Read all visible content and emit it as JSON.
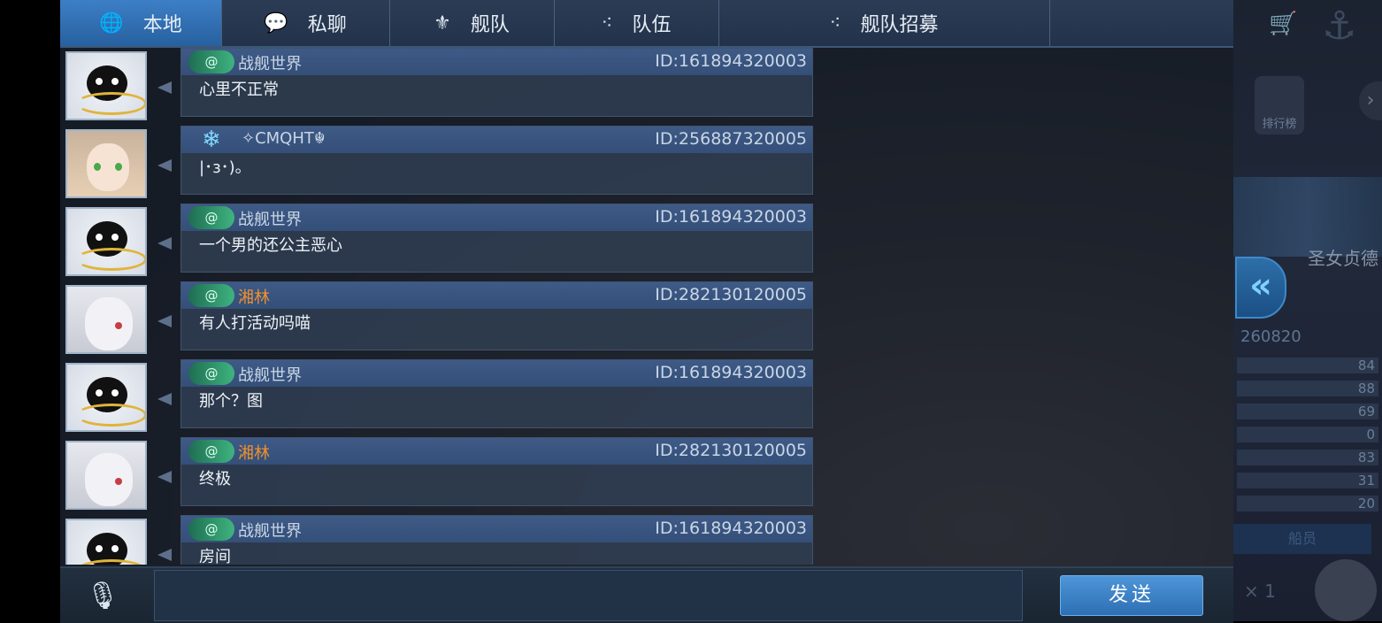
{
  "tabs": [
    {
      "label": "本地",
      "icon": "globe-icon",
      "glyph": "🌐"
    },
    {
      "label": "私聊",
      "icon": "chat-bubble-icon",
      "glyph": "💬"
    },
    {
      "label": "舰队",
      "icon": "fleet-emblem-icon",
      "glyph": "⚜"
    },
    {
      "label": "队伍",
      "icon": "team-dots-icon",
      "glyph": "⁖"
    },
    {
      "label": "舰队招募",
      "icon": "team-dots-icon",
      "glyph": "⁖"
    }
  ],
  "messages": [
    {
      "avatar": "bear",
      "badge": "@",
      "badge_icon": "rank-badge-icon",
      "name": "战舰世界",
      "name_color": "default",
      "id": "ID:161894320003",
      "text": "心里不正常"
    },
    {
      "avatar": "girl",
      "badge": "❄",
      "badge_icon": "snowflake-badge-icon",
      "name": "✧CMQHT☬",
      "name_color": "default",
      "id": "ID:256887320005",
      "text": "|･з･)。"
    },
    {
      "avatar": "bear",
      "badge": "@",
      "badge_icon": "rank-badge-icon",
      "name": "战舰世界",
      "name_color": "default",
      "id": "ID:161894320003",
      "text": "一个男的还公主恶心"
    },
    {
      "avatar": "white",
      "badge": "@",
      "badge_icon": "rank-badge-icon",
      "name": "湘林",
      "name_color": "orange",
      "id": "ID:282130120005",
      "text": "有人打活动吗喵"
    },
    {
      "avatar": "bear",
      "badge": "@",
      "badge_icon": "rank-badge-icon",
      "name": "战舰世界",
      "name_color": "default",
      "id": "ID:161894320003",
      "text": "那个？图"
    },
    {
      "avatar": "white",
      "badge": "@",
      "badge_icon": "rank-badge-icon",
      "name": "湘林",
      "name_color": "orange",
      "id": "ID:282130120005",
      "text": "终极"
    },
    {
      "avatar": "bear",
      "badge": "@",
      "badge_icon": "rank-badge-icon",
      "name": "战舰世界",
      "name_color": "default",
      "id": "ID:161894320003",
      "text": "房间"
    }
  ],
  "bottom": {
    "mic_icon": "microphone-icon",
    "mic_glyph": "🎙",
    "input_value": "",
    "send_label": "发送"
  },
  "collapse_glyph": "«",
  "side": {
    "player_id": "260820",
    "title": "圣女贞德",
    "stats": [
      "84",
      "88",
      "69",
      "0",
      "83",
      "31",
      "20"
    ],
    "role_label": "船员",
    "count": "× 1",
    "cart_glyph": "🛒",
    "anchor_glyph": "⚓",
    "arrow_glyph": "›",
    "emblem_label": "排行榜"
  },
  "colors": {
    "tab_active": "#3d7fc6",
    "name_orange": "#f0912e",
    "send_button": "#2e6fb4",
    "badge_green": "#3fb37f"
  }
}
